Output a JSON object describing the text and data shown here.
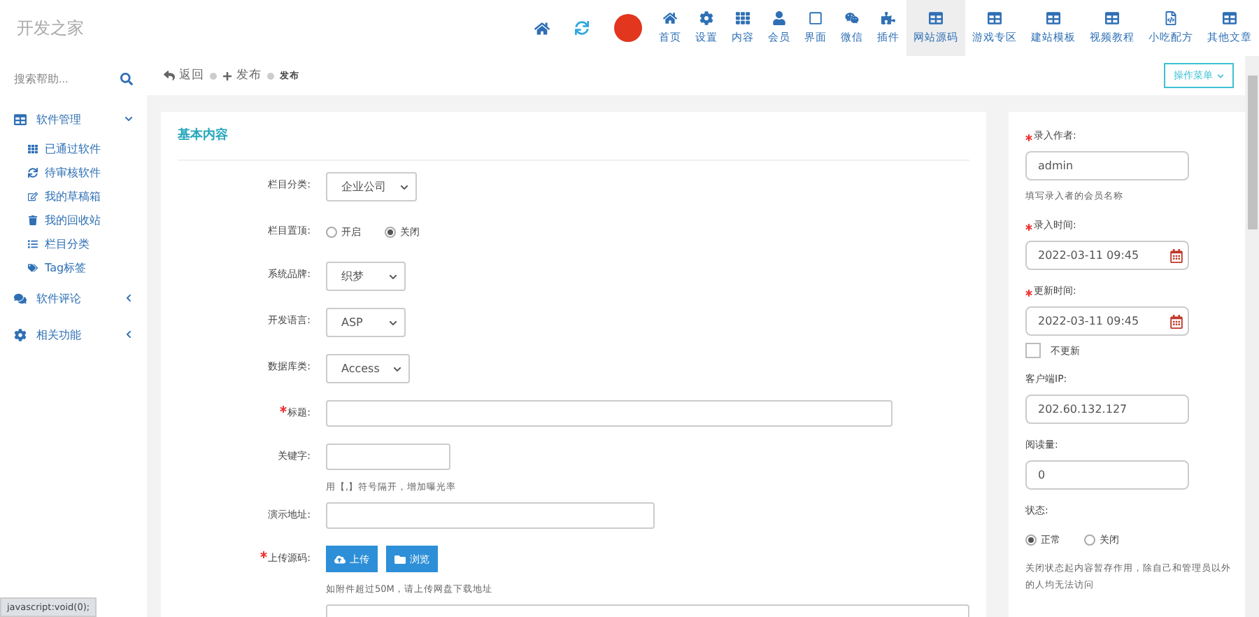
{
  "header": {
    "logo": "开发之家",
    "nav": [
      {
        "label": "首页",
        "selected": false
      },
      {
        "label": "设置",
        "selected": false
      },
      {
        "label": "内容",
        "selected": false
      },
      {
        "label": "会员",
        "selected": false
      },
      {
        "label": "界面",
        "selected": false
      },
      {
        "label": "微信",
        "selected": false
      },
      {
        "label": "插件",
        "selected": false
      },
      {
        "label": "网站源码",
        "selected": true
      },
      {
        "label": "游戏专区",
        "selected": false
      },
      {
        "label": "建站模板",
        "selected": false
      },
      {
        "label": "视频教程",
        "selected": false
      },
      {
        "label": "小吃配方",
        "selected": false
      },
      {
        "label": "其他文章",
        "selected": false
      }
    ]
  },
  "sidebar": {
    "search": {
      "placeholder": "搜索帮助..."
    },
    "items": [
      {
        "label": "软件管理",
        "expanded": true,
        "children": [
          {
            "label": "已通过软件"
          },
          {
            "label": "待审核软件"
          },
          {
            "label": "我的草稿箱"
          },
          {
            "label": "我的回收站"
          },
          {
            "label": "栏目分类"
          },
          {
            "label": "Tag标签"
          }
        ]
      },
      {
        "label": "软件评论",
        "expanded": false
      },
      {
        "label": "相关功能",
        "expanded": false
      }
    ]
  },
  "toolbar": {
    "links": [
      "返回",
      "发布"
    ],
    "current": "发布",
    "menu_button": "操作菜单"
  },
  "main_card": {
    "title": "基本内容",
    "fields": [
      {
        "kind": "select",
        "label": "栏目分类:",
        "value": "企业公司"
      },
      {
        "kind": "radio",
        "label": "栏目置顶:",
        "options": [
          {
            "label": "开启",
            "selected": false
          },
          {
            "label": "关闭",
            "selected": true
          }
        ]
      },
      {
        "kind": "select",
        "label": "系统品牌:",
        "value": "织梦"
      },
      {
        "kind": "select",
        "label": "开发语言:",
        "value": "ASP"
      },
      {
        "kind": "select",
        "label": "数据库类:",
        "value": "Access"
      },
      {
        "kind": "text",
        "label": "标题:",
        "required": true
      },
      {
        "kind": "text",
        "label": "关键字:",
        "required": false,
        "hint": "用【,】符号隔开，增加曝光率"
      },
      {
        "kind": "text",
        "label": "演示地址:",
        "required": false
      },
      {
        "kind": "upload",
        "label": "上传源码:",
        "required": true,
        "buttons": [
          "上传",
          "浏览"
        ],
        "hint": "如附件超过50M，请上传网盘下载地址"
      },
      {
        "kind": "text"
      }
    ]
  },
  "side_card": {
    "fields": [
      {
        "kind": "text",
        "label": "录入作者:",
        "required": true,
        "value": "admin",
        "hint": "填写录入者的会员名称"
      },
      {
        "kind": "date",
        "label": "录入时间:",
        "required": true,
        "value": "2022-03-11 09:45"
      },
      {
        "kind": "date",
        "label": "更新时间:",
        "required": true,
        "value": "2022-03-11 09:45",
        "checkbox": {
          "label": "不更新",
          "checked": false
        }
      },
      {
        "kind": "text",
        "label": "客户端IP:",
        "required": false,
        "value": "202.60.132.127"
      },
      {
        "kind": "text",
        "label": "阅读量:",
        "required": false,
        "value": "0"
      },
      {
        "kind": "radio",
        "label": "状态:",
        "options": [
          {
            "label": "正常",
            "selected": true
          },
          {
            "label": "关闭",
            "selected": false
          }
        ],
        "hint": "关闭状态起内容暂存作用，除自己和管理员以外的人均无法访问"
      }
    ]
  },
  "status_bar": "javascript:void(0);"
}
